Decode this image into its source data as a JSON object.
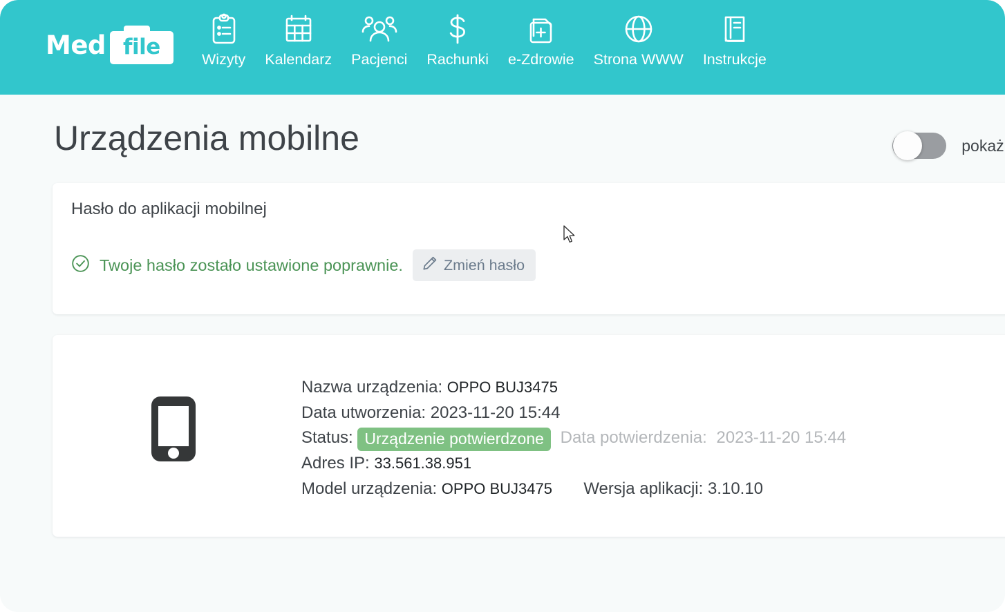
{
  "brand": {
    "name_part1": "Med",
    "name_part2": "file"
  },
  "nav": {
    "items": [
      {
        "label": "Wizyty",
        "icon": "clipboard-icon"
      },
      {
        "label": "Kalendarz",
        "icon": "calendar-icon"
      },
      {
        "label": "Pacjenci",
        "icon": "users-icon"
      },
      {
        "label": "Rachunki",
        "icon": "dollar-icon"
      },
      {
        "label": "e-Zdrowie",
        "icon": "document-plus-icon"
      },
      {
        "label": "Strona WWW",
        "icon": "globe-icon"
      },
      {
        "label": "Instrukcje",
        "icon": "book-icon"
      }
    ]
  },
  "page": {
    "title": "Urządzenia mobilne",
    "toggle_label": "pokaż usunięte",
    "toggle_state": "off"
  },
  "password_card": {
    "title": "Hasło do aplikacji mobilnej",
    "status_text": "Twoje hasło zostało ustawione poprawnie.",
    "change_button": "Zmień hasło"
  },
  "device_card": {
    "labels": {
      "name": "Nazwa urządzenia:",
      "created": "Data utworzenia:",
      "status": "Status:",
      "confirmed_date": "Data potwierdzenia:",
      "ip": "Adres IP:",
      "model": "Model urządzenia:",
      "app_version": "Wersja aplikacji:"
    },
    "values": {
      "name": "OPPO BUJ3475",
      "created": "2023-11-20 15:44",
      "status_badge": "Urządzenie potwierdzone",
      "confirmed_date": "2023-11-20 15:44",
      "ip": "33.561.38.951",
      "model": "OPPO BUJ3475",
      "app_version": "3.10.10"
    }
  },
  "colors": {
    "brand_teal": "#32c6cc",
    "page_bg": "#f7fafa",
    "success_green": "#4b9456",
    "badge_green": "#7fc183",
    "text_dark": "#3e4348",
    "muted": "#b4b7ba"
  }
}
